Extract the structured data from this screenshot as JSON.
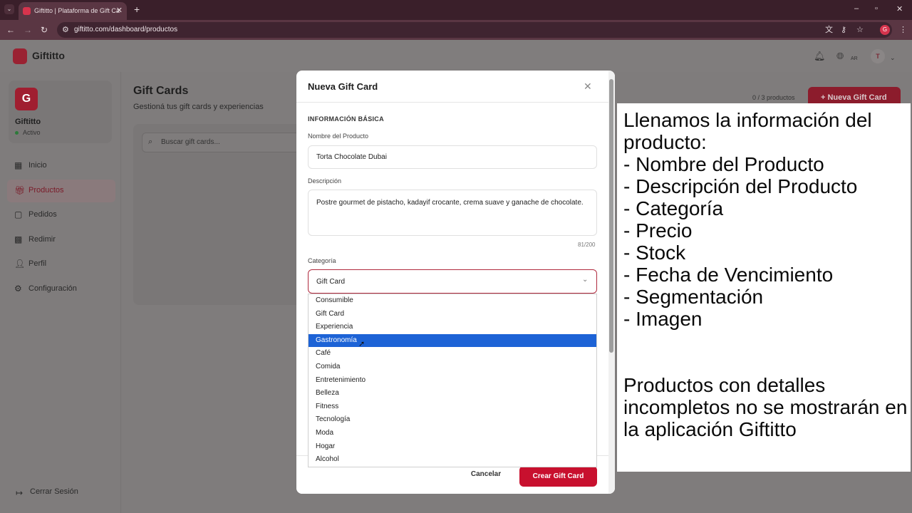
{
  "browser": {
    "tab_title": "Giftitto | Plataforma de Gift Ca",
    "url": "giftitto.com/dashboard/productos"
  },
  "app": {
    "brand": "Giftitto",
    "header_lang": "AR",
    "avatar_initial": "T"
  },
  "sidebar": {
    "store_name": "Giftitto",
    "store_status": "Activo",
    "items": [
      {
        "label": "Inicio",
        "icon": "grid-icon"
      },
      {
        "label": "Productos",
        "icon": "gift-icon"
      },
      {
        "label": "Pedidos",
        "icon": "bag-icon"
      },
      {
        "label": "Redimir",
        "icon": "qr-icon"
      },
      {
        "label": "Perfil",
        "icon": "user-icon"
      },
      {
        "label": "Configuración",
        "icon": "gear-icon"
      }
    ],
    "logout_label": "Cerrar Sesión"
  },
  "main": {
    "title": "Gift Cards",
    "subtitle": "Gestioná tus gift cards y experiencias",
    "count": "0 / 3 productos",
    "new_button": "+ Nueva Gift Card",
    "search_placeholder": "Buscar gift cards..."
  },
  "modal": {
    "title": "Nueva Gift Card",
    "section": "INFORMACIÓN BÁSICA",
    "name_label": "Nombre del Producto",
    "name_value": "Torta Chocolate Dubai",
    "desc_label": "Descripción",
    "desc_value": "Postre gourmet de pistacho, kadayif crocante, crema suave y ganache de chocolate.",
    "desc_counter": "81/200",
    "category_label": "Categoría",
    "category_value": "Gift Card",
    "options": [
      "Consumible",
      "Gift Card",
      "Experiencia",
      "Gastronomía",
      "Café",
      "Comida",
      "Entretenimiento",
      "Belleza",
      "Fitness",
      "Tecnología",
      "Moda",
      "Hogar",
      "Alcohol"
    ],
    "highlighted_option": "Gastronomía",
    "cancel_label": "Cancelar",
    "create_label": "Crear Gift Card"
  },
  "annotation": {
    "text": "Llenamos la información del producto:\n- Nombre del Producto\n- Descripción del Producto\n- Categoría\n- Precio\n- Stock\n- Fecha de Vencimiento\n- Segmentación\n- Imagen\n\n\nProductos con detalles incompletos no se mostrarán en la aplicación Giftitto"
  },
  "colors": {
    "brand": "#c8102e",
    "highlight": "#1d63d6"
  }
}
